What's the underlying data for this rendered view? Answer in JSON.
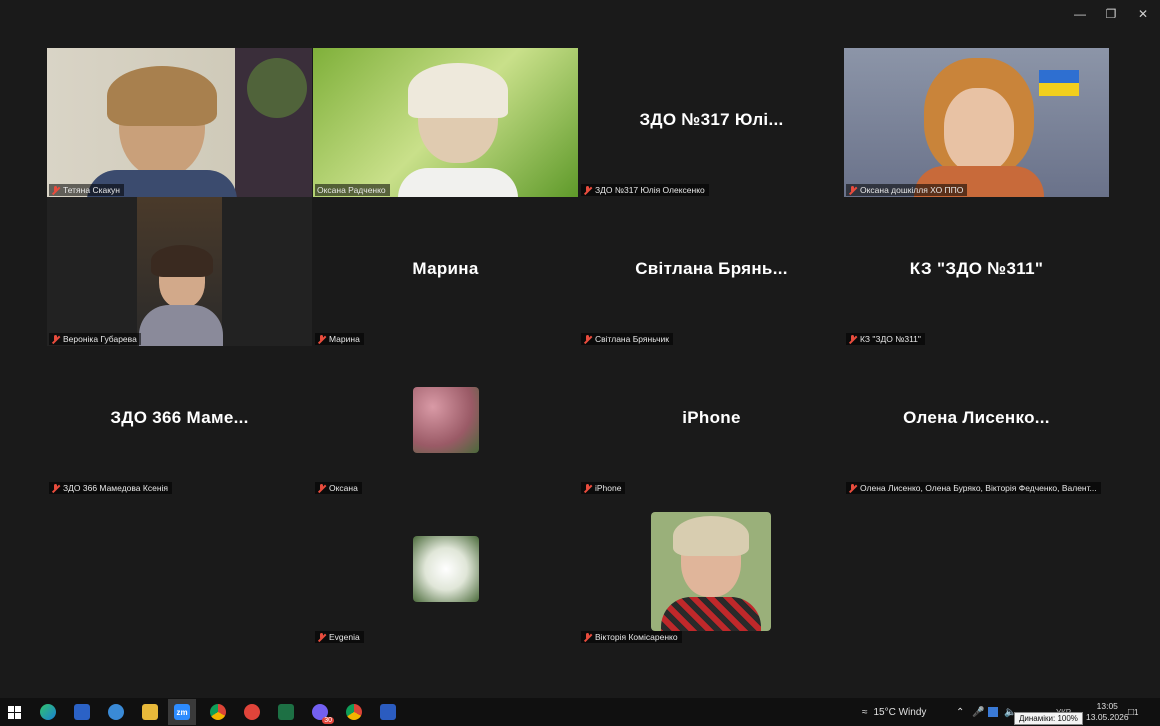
{
  "window": {
    "minimize_icon": "minimize-icon",
    "restore_icon": "restore-icon",
    "close_icon": "close-icon"
  },
  "tiles": [
    {
      "name": "Тетяна Скакун",
      "big": ""
    },
    {
      "name": "Оксана Радченко",
      "big": ""
    },
    {
      "name": "ЗДО №317 Юлія Олексенко",
      "big": "ЗДО №317 Юлі..."
    },
    {
      "name": "Оксана дошкілля ХО ППО",
      "big": ""
    },
    {
      "name": "Вероніка Губарева",
      "big": ""
    },
    {
      "name": "Марина",
      "big": "Марина"
    },
    {
      "name": "Світлана Бряньчик",
      "big": "Світлана Брянь..."
    },
    {
      "name": "КЗ \"ЗДО №311\"",
      "big": "КЗ \"ЗДО №311\""
    },
    {
      "name": "ЗДО 366 Мамедова Ксенія",
      "big": "ЗДО 366 Маме..."
    },
    {
      "name": "Оксана",
      "big": ""
    },
    {
      "name": "iPhone",
      "big": "iPhone"
    },
    {
      "name": "Олена Лисенко, Олена Буряко, Вікторія Федченко, Валент...",
      "big": "Олена  Лисенко..."
    },
    {
      "name": "Evgenia",
      "big": ""
    },
    {
      "name": "Вікторія Комісаренко",
      "big": ""
    }
  ],
  "taskbar": {
    "weather": "15°C  Windy",
    "language": "УКР",
    "time": "13:05",
    "date": "13.05.2026",
    "tooltip": "Динаміки: 100%",
    "notifications": "1",
    "viber_badge": "30"
  }
}
